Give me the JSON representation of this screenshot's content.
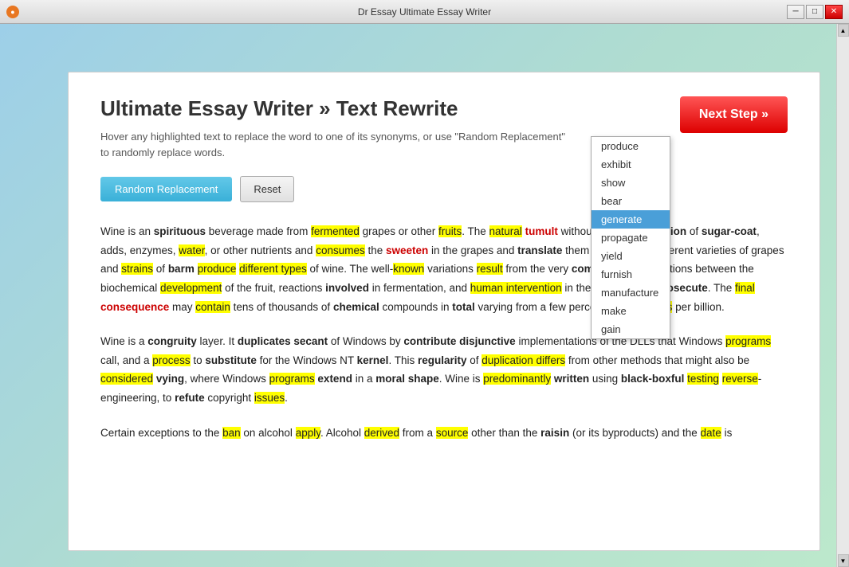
{
  "window": {
    "title": "Dr Essay Ultimate Essay Writer",
    "titlebar_icon": "●"
  },
  "header": {
    "page_title": "Ultimate Essay Writer » Text Rewrite",
    "subtitle_line1": "Hover any highlighted text to replace the word to one of its synonyms, or use \"Random Replacement\"",
    "subtitle_line2": "to randomly replace words."
  },
  "buttons": {
    "random_replacement": "Random Replacement",
    "reset": "Reset",
    "next_step": "Next Step »"
  },
  "dropdown": {
    "items": [
      {
        "label": "produce",
        "selected": false
      },
      {
        "label": "exhibit",
        "selected": false
      },
      {
        "label": "show",
        "selected": false
      },
      {
        "label": "bear",
        "selected": false
      },
      {
        "label": "generate",
        "selected": true
      },
      {
        "label": "propagate",
        "selected": false
      },
      {
        "label": "yield",
        "selected": false
      },
      {
        "label": "furnish",
        "selected": false
      },
      {
        "label": "manufacture",
        "selected": false
      },
      {
        "label": "make",
        "selected": false
      },
      {
        "label": "gain",
        "selected": false
      }
    ]
  },
  "essay": {
    "para1_start": "Wine is an ",
    "para1": "Wine is an spirituous beverage made from fermented grapes or other fruits. The natural tumult without the augmentation of sugar-coat, adds, enzymes, water, or other nutrients and consumes the sweeten in the grapes and translate them into alcohol. Different varieties of grapes and strains of barm produce different types of wine. The well-known variations result from the very complicated interactions between the biochemical development of the fruit, reactions involved in fermentation, and human intervention in the everywhere prosecute. The final consequence may contain tens of thousands of chemical compounds in total varying from a few percent to a few parts per billion.",
    "para2": "Wine is a congruity layer. It duplicates secant of Windows by contribute disjunctive implementations of the DLLs that Windows programs call, and a process to substitute for the Windows NT kernel. This regularity of duplication differs from other methods that might also be considered vying, where Windows programs extend in a moral shape. Wine is predominantly written using black-boxful testing reverse-engineering, to refute copyright issues.",
    "para3_start": "Certain exceptions to the ban on alcohol apply. Alcohol derived from a source other than the raisin (or its byproducts) and the date is"
  }
}
